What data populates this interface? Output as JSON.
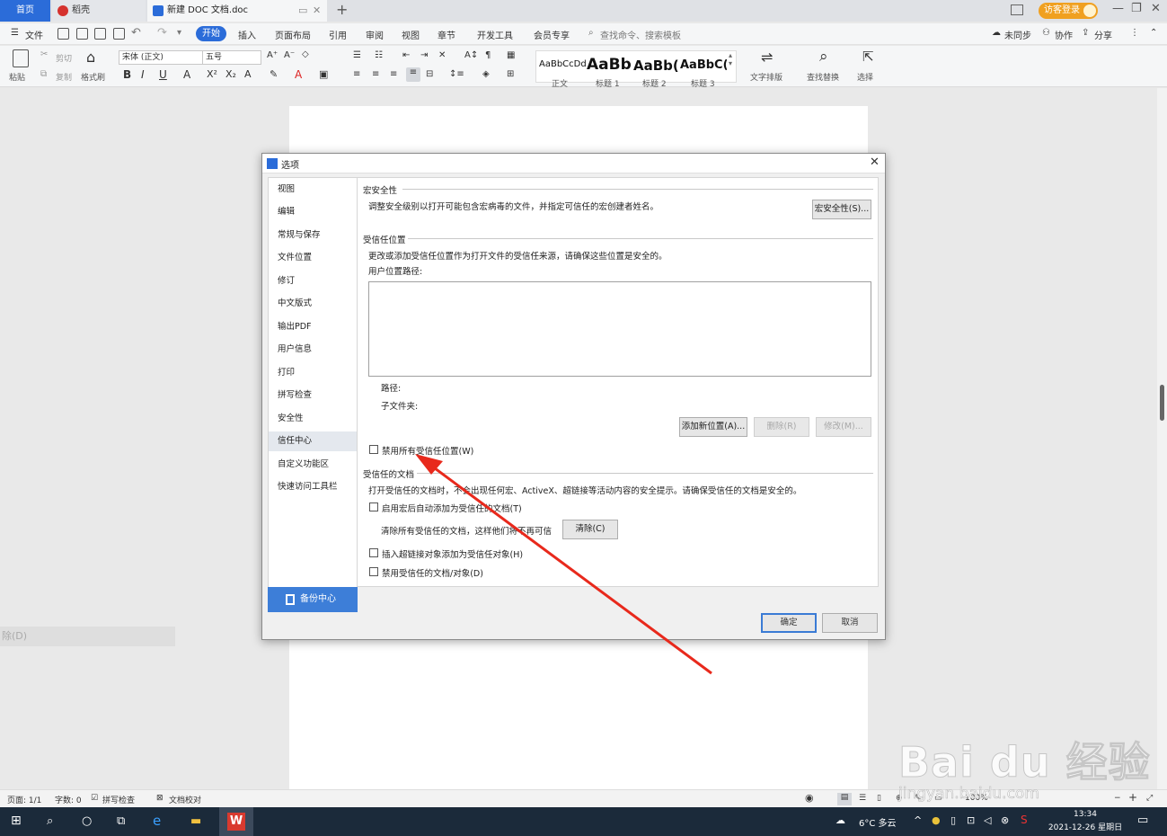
{
  "tabs": {
    "home": "首页",
    "daoke": "稻壳",
    "doc": "新建 DOC 文档.doc",
    "new_tab": "+"
  },
  "titlebar": {
    "login": "访客登录"
  },
  "menubar": {
    "file": "文件",
    "items": [
      "开始",
      "插入",
      "页面布局",
      "引用",
      "审阅",
      "视图",
      "章节",
      "开发工具",
      "会员专享"
    ],
    "search_placeholder": "查找命令、搜索模板",
    "sync": "未同步",
    "collab": "协作",
    "share": "分享"
  },
  "ribbon": {
    "paste": "粘贴",
    "cut": "剪切",
    "copy": "复制",
    "format_painter": "格式刷",
    "font_name": "宋体 (正文)",
    "font_size": "五号",
    "styles": [
      {
        "preview": "AaBbCcDd",
        "label": "正文"
      },
      {
        "preview": "AaBb",
        "label": "标题 1"
      },
      {
        "preview": "AaBb(",
        "label": "标题 2"
      },
      {
        "preview": "AaBbC(",
        "label": "标题 3"
      }
    ],
    "text_layout": "文字排版",
    "find_replace": "查找替换",
    "select": "选择"
  },
  "dialog": {
    "title": "选项",
    "nav": [
      "视图",
      "编辑",
      "常规与保存",
      "文件位置",
      "修订",
      "中文版式",
      "输出PDF",
      "用户信息",
      "打印",
      "拼写检查",
      "安全性",
      "信任中心",
      "自定义功能区",
      "快速访问工具栏"
    ],
    "selected_nav": "信任中心",
    "backup": "备份中心",
    "macro_section": "宏安全性",
    "macro_desc": "调整安全级别以打开可能包含宏病毒的文件，并指定可信任的宏创建者姓名。",
    "macro_button": "宏安全性(S)...",
    "trusted_loc_section": "受信任位置",
    "trusted_loc_desc": "更改或添加受信任位置作为打开文件的受信任来源，请确保这些位置是安全的。",
    "user_path_label": "用户位置路径:",
    "path_label": "路径:",
    "subfolder_label": "子文件夹:",
    "add_location": "添加新位置(A)...",
    "delete": "删除(R)",
    "modify": "修改(M)...",
    "disable_all_locations": "禁用所有受信任位置(W)",
    "trusted_docs_section": "受信任的文档",
    "trusted_docs_desc": "打开受信任的文档时，不会出现任何宏、ActiveX、超链接等活动内容的安全提示。请确保受信任的文档是安全的。",
    "auto_add": "启用宏后自动添加为受信任的文档(T)",
    "clear_desc": "清除所有受信任的文档，这样他们将不再可信",
    "clear_button": "清除(C)",
    "hyperlink_trust": "插入超链接对象添加为受信任对象(H)",
    "disable_trusted_docs": "禁用受信任的文档/对象(D)",
    "ok": "确定",
    "cancel": "取消"
  },
  "left_remnant": "除(D)",
  "statusbar": {
    "page": "页面: 1/1",
    "words": "字数: 0",
    "spell": "拼写检查",
    "proof": "文档校对",
    "zoom": "100%"
  },
  "taskbar": {
    "weather": "6°C 多云",
    "time": "13:34",
    "date": "2021-12-26 星期日"
  },
  "watermark": {
    "brand": "Bai du 经验",
    "url": "jingyan.baidu.com"
  },
  "colors": {
    "accent": "#2b6cd9",
    "arrow": "#e8291c"
  }
}
